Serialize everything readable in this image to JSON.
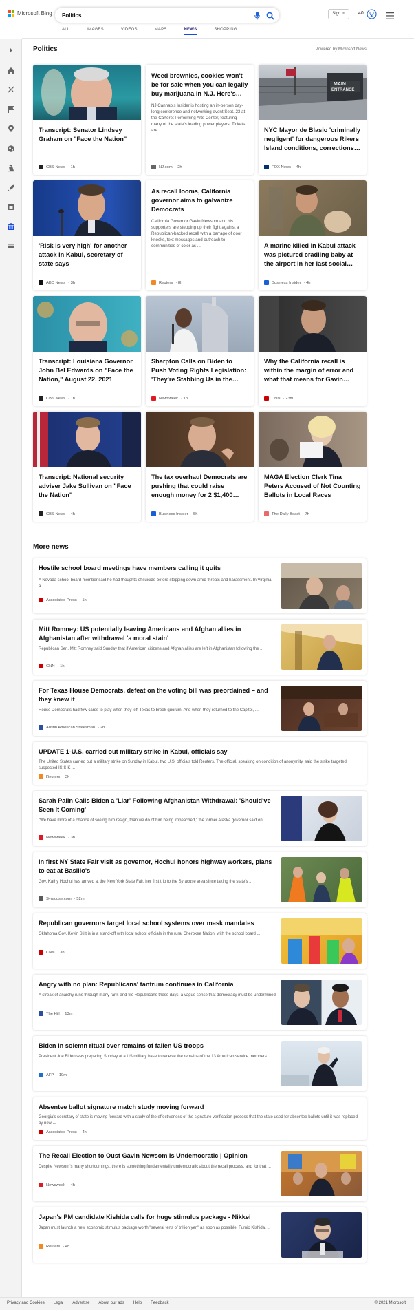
{
  "header": {
    "logo_text": "Microsoft Bing",
    "search_value": "Politics",
    "signin_label": "Sign in",
    "rewards_count": "40",
    "tabs": [
      {
        "label": "ALL"
      },
      {
        "label": "IMAGES"
      },
      {
        "label": "VIDEOS"
      },
      {
        "label": "MAPS"
      },
      {
        "label": "NEWS"
      },
      {
        "label": "SHOPPING"
      }
    ],
    "active_tab": "NEWS"
  },
  "section": {
    "title": "Politics",
    "powered_by": "Powered by Microsoft News"
  },
  "top_cards": [
    {
      "title": "Transcript: Senator Lindsey Graham on \"Face the Nation\"",
      "source": "CBS News",
      "time": "· 1h",
      "logo_color": "#222222"
    },
    {
      "title": "Weed brownies, cookies won't be for sale when you can legally buy marijuana in N.J. Here's…",
      "snippet": "NJ Cannabis Insider is hosting an in-person day-long conference and networking event Sept. 23 at the Carteret Performing Arts Center, featuring many of the state's leading power players. Tickets are ...",
      "source": "NJ.com",
      "time": "· 2h",
      "logo_color": "#666666"
    },
    {
      "title": "NYC Mayor de Blasio 'criminally negligent' for dangerous Rikers Island conditions, corrections…",
      "source": "FOX News",
      "time": "· 4h",
      "logo_color": "#003366"
    },
    {
      "title": "'Risk is very high' for another attack in Kabul, secretary of state says",
      "source": "ABC News",
      "time": "· 3h",
      "logo_color": "#111111"
    },
    {
      "title": "As recall looms, California governor aims to galvanize Democrats",
      "snippet": "California Governor Gavin Newsom and his supporters are stepping up their fight against a Republican-backed recall with a barrage of door knocks, text messages and outreach to communities of color as ...",
      "source": "Reuters",
      "time": "· 8h",
      "logo_color": "#f08a24"
    },
    {
      "title": "A marine killed in Kabul attack was pictured cradling baby at the airport in her last social…",
      "source": "Business Insider",
      "time": "· 4h",
      "logo_color": "#1760d8"
    },
    {
      "title": "Transcript: Louisiana Governor John Bel Edwards on \"Face the Nation,\" August 22, 2021",
      "source": "CBS News",
      "time": "· 1h",
      "logo_color": "#222222"
    },
    {
      "title": "Sharpton Calls on Biden to Push Voting Rights Legislation: 'They're Stabbing Us in the…",
      "source": "Newsweek",
      "time": "· 1h",
      "logo_color": "#e01a22"
    },
    {
      "title": "Why the California recall is within the margin of error and what that means for Gavin…",
      "source": "CNN",
      "time": "· 23m",
      "logo_color": "#cc0000"
    },
    {
      "title": "Transcript: National security adviser Jake Sullivan on \"Face the Nation\"",
      "source": "CBS News",
      "time": "· 4h",
      "logo_color": "#222222"
    },
    {
      "title": "The tax overhaul Democrats are pushing that could raise enough money for 2 $1,400…",
      "source": "Business Insider",
      "time": "· 5h",
      "logo_color": "#1760d8"
    },
    {
      "title": "MAGA Election Clerk Tina Peters Accused of Not Counting Ballots in Local Races",
      "source": "The Daily Beast",
      "time": "· 7h",
      "logo_color": "#e86a6a"
    }
  ],
  "more_news": {
    "title": "More news",
    "items": [
      {
        "title": "Hostile school board meetings have members calling it quits",
        "snippet": "A Nevada school board member said he had thoughts of suicide before stepping down amid threats and harassment. In Virginia, a ...",
        "source": "Associated Press",
        "time": "· 1h",
        "logo_color": "#cc0000",
        "logo_text": "AP"
      },
      {
        "title": "Mitt Romney: US potentially leaving Americans and Afghan allies in Afghanistan after withdrawal 'a moral stain'",
        "snippet": "Republican Sen. Mitt Romney said Sunday that if American citizens and Afghan allies are left in Afghanistan following the ...",
        "source": "CNN",
        "time": "· 1h",
        "logo_color": "#cc0000",
        "logo_text": ""
      },
      {
        "title": "For Texas House Democrats, defeat on the voting bill was preordained – and they knew it",
        "snippet": "House Democrats had few cards to play when they left Texas to break quorum. And when they returned to the Capitol, ...",
        "source": "Austin American Statesman",
        "time": "· 2h",
        "logo_color": "#2d4fa3",
        "logo_text": ""
      },
      {
        "title": "UPDATE 1-U.S. carried out military strike in Kabul, officials say",
        "snippet": "The United States carried out a military strike on Sunday in Kabul, two U.S. officials told Reuters. The official, speaking on condition of anonymity, said the strike targeted suspected ISIS-K ...",
        "source": "Reuters",
        "time": "· 2h",
        "logo_color": "#f08a24",
        "logo_text": ""
      },
      {
        "title": "Sarah Palin Calls Biden a 'Liar' Following Afghanistan Withdrawal: 'Should've Seen It Coming'",
        "snippet": "\"We have more of a chance of seeing him resign, than we do of him being impeached,\" the former Alaska governor said on ...",
        "source": "Newsweek",
        "time": "· 3h",
        "logo_color": "#e01a22",
        "logo_text": ""
      },
      {
        "title": "In first NY State Fair visit as governor, Hochul honors highway workers, plans to eat at Basilio's",
        "snippet": "Gov. Kathy Hochul has arrived at the New York State Fair, her first trip to the Syracuse area since taking the state's ...",
        "source": "Syracuse.com",
        "time": "· 52m",
        "logo_color": "#5a5a5a",
        "logo_text": ""
      },
      {
        "title": "Republican governors target local school systems over mask mandates",
        "snippet": "Oklahoma Gov. Kevin Stitt is in a stand-off with local school officials in the rural Cherokee Nation, with the school board ...",
        "source": "CNN",
        "time": "· 3h",
        "logo_color": "#cc0000",
        "logo_text": ""
      },
      {
        "title": "Angry with no plan: Republicans' tantrum continues in California",
        "snippet": "A streak of anarchy runs through many rank-and-file Republicans these days, a vague sense that democracy must be undermined ...",
        "source": "The Hill",
        "time": "· 13m",
        "logo_color": "#2a4f9e",
        "logo_text": ""
      },
      {
        "title": "Biden in solemn ritual over remains of fallen US troops",
        "snippet": "President Joe Biden was preparing Sunday at a US military base to receive the remains of the 13 American service members ...",
        "source": "AFP",
        "time": "· 19m",
        "logo_color": "#1b6fcf",
        "logo_text": ""
      },
      {
        "title": "Absentee ballot signature match study moving forward",
        "snippet": "Georgia's secretary of state is moving forward with a study of the effectiveness of the signature verification process that the state used for absentee ballots until it was replaced by new ...",
        "source": "Associated Press",
        "time": "· 4h",
        "logo_color": "#cc0000",
        "logo_text": "AP"
      },
      {
        "title": "The Recall Election to Oust Gavin Newsom Is Undemocratic | Opinion",
        "snippet": "Despite Newsom's many shortcomings, there is something fundamentally undemocratic about the recall process, and for that ...",
        "source": "Newsweek",
        "time": "· 4h",
        "logo_color": "#e01a22",
        "logo_text": ""
      },
      {
        "title": "Japan's PM candidate Kishida calls for huge stimulus package - Nikkei",
        "snippet": "Japan must launch a new economic stimulus package worth \"several tens of trillion yen\" as soon as possible, Fumio Kishida, ...",
        "source": "Reuters",
        "time": "· 4h",
        "logo_color": "#f08a24",
        "logo_text": ""
      }
    ]
  },
  "footer": {
    "links": [
      "Privacy and Cookies",
      "Legal",
      "Advertise",
      "About our ads",
      "Help",
      "Feedback"
    ],
    "copyright": "© 2021 Microsoft"
  },
  "icons": {
    "sidebar": [
      "expand-arrow-icon",
      "home-icon",
      "sports-icon",
      "flag-icon",
      "location-icon",
      "globe-icon",
      "science-icon",
      "rocket-icon",
      "entertainment-icon",
      "politics-icon",
      "money-icon"
    ],
    "header": [
      "mic-icon",
      "search-icon",
      "trophy-icon",
      "hamburger-menu-icon"
    ]
  },
  "colors": {
    "accent": "#174ae4",
    "sidebar_bg": "#f3f3f3",
    "active_politics": "#174ae4"
  }
}
